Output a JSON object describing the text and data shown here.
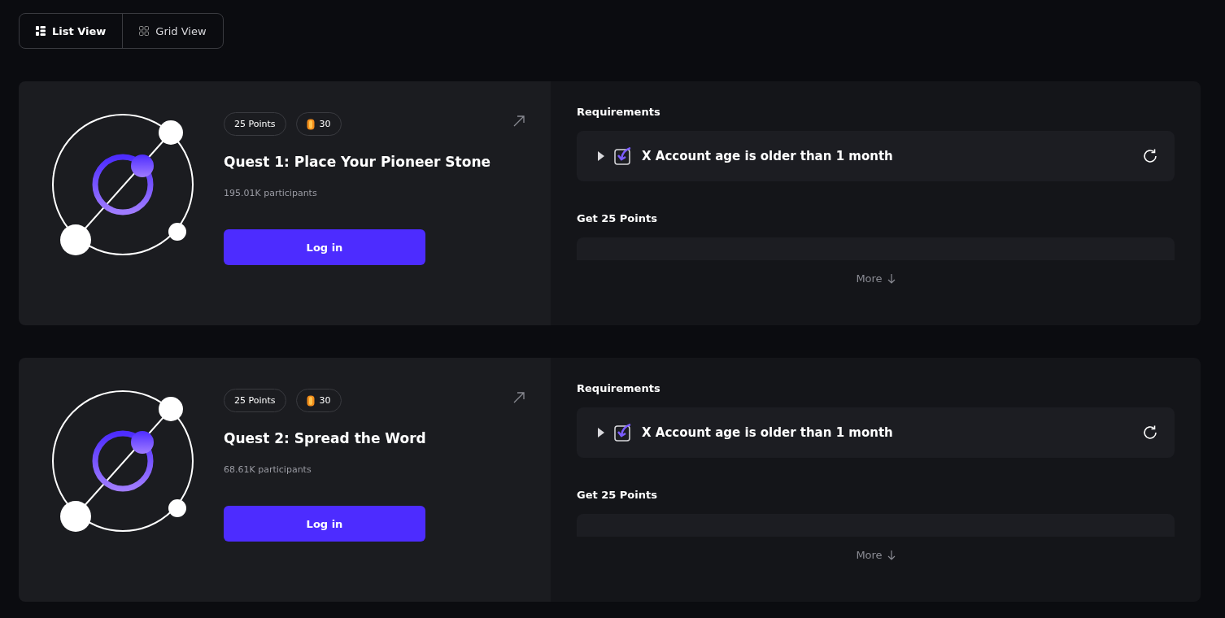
{
  "view_toggle": [
    {
      "label": "List View",
      "selected": true
    },
    {
      "label": "Grid View",
      "selected": false
    }
  ],
  "quests": [
    {
      "points_badge": "25 Points",
      "gem_badge": "30",
      "title": "Quest 1: Place Your Pioneer Stone",
      "participants": "195.01K participants",
      "button": "Log in",
      "requirements_heading": "Requirements",
      "requirements": [
        {
          "label": "X Account age is older than 1 month"
        }
      ],
      "rewards_heading": "Get 25 Points",
      "more": "More"
    },
    {
      "points_badge": "25 Points",
      "gem_badge": "30",
      "title": "Quest 2: Spread the Word",
      "participants": "68.61K participants",
      "button": "Log in",
      "requirements_heading": "Requirements",
      "requirements": [
        {
          "label": "X Account age is older than 1 month"
        }
      ],
      "rewards_heading": "Get 25 Points",
      "more": "More"
    }
  ]
}
